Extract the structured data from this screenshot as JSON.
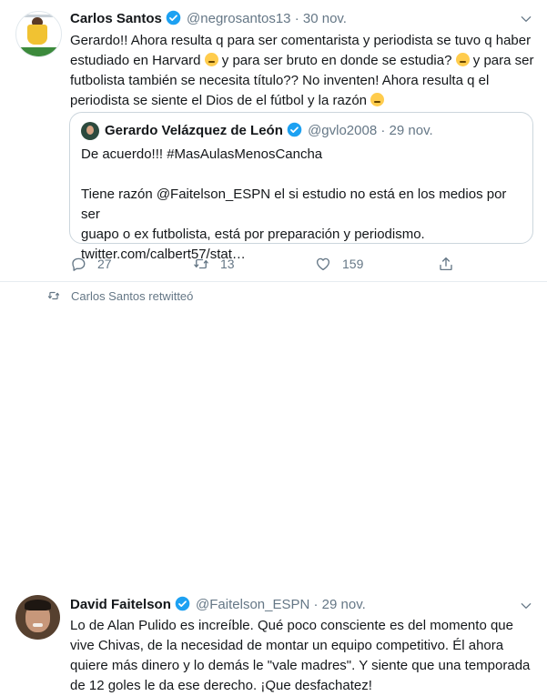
{
  "tweet1": {
    "name": "Carlos Santos",
    "handle": "@negrosantos13",
    "separator": "·",
    "date": "30 nov.",
    "text_lines": [
      "Gerardo!! Ahora resulta q para ser comentarista y periodista se tuvo q haber",
      "estudiado en Harvard",
      " y para ser bruto en donde se estudia?",
      " y para ser",
      "futbolista también se necesita título?? No inventen! Ahora resulta q el",
      "periodista se siente el Dios de el fútbol y la razón"
    ],
    "quoted": {
      "name": "Gerardo Velázquez de León",
      "handle": "@gvlo2008",
      "separator": "·",
      "date": "29 nov.",
      "line1": "De acuerdo!!! #MasAulasMenosCancha",
      "line2": "Tiene razón @Faitelson_ESPN el si estudio no está en los medios por ser",
      "line3": "guapo o ex futbolista, está por preparación y periodismo.",
      "line4": "twitter.com/calbert57/stat…"
    },
    "actions": {
      "replies": "27",
      "retweets": "13",
      "likes": "159"
    }
  },
  "retweet_context": "Carlos Santos retwitteó",
  "tweet2": {
    "name": "David Faitelson",
    "handle": "@Faitelson_ESPN",
    "separator": "·",
    "date": "29 nov.",
    "text_lines": [
      "Lo de Alan Pulido es increíble. Qué poco consciente es del momento que",
      "vive Chivas, de la necesidad de montar un equipo competitivo. Él ahora",
      "quiere más dinero y lo demás le \"vale madres\". Y  siente que una temporada",
      "de 12 goles le da ese derecho. ¡Que desfachatez!"
    ]
  },
  "colors": {
    "link": "#1b95e0",
    "secondary": "#657786",
    "verified": "#1da1f2",
    "border": "#e6ecf0"
  }
}
